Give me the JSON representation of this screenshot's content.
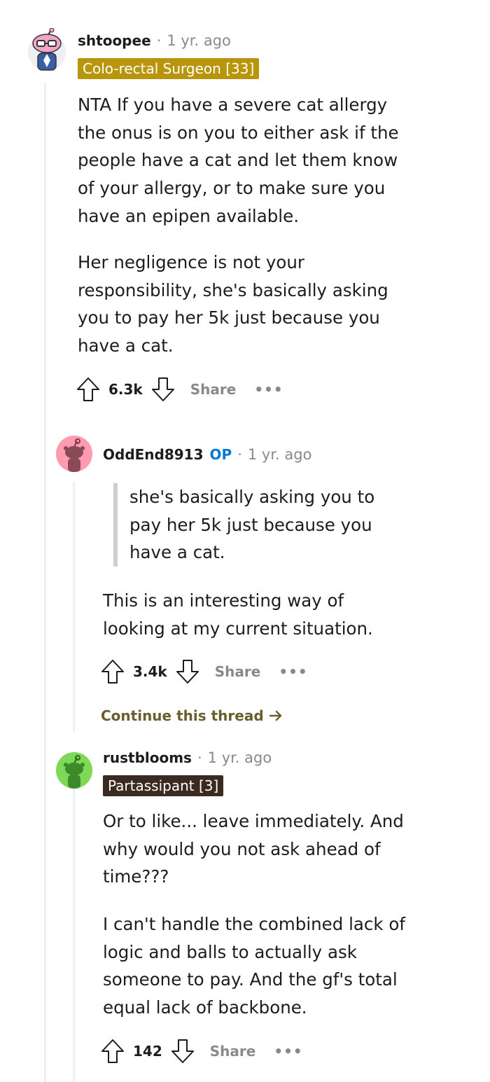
{
  "comments": [
    {
      "username": "shtoopee",
      "time": "1 yr. ago",
      "flair": "Colo-rectal Surgeon [33]",
      "flair_color": "#b8950b",
      "paragraphs": [
        "NTA If you have a severe cat allergy the onus is on you to either ask if the people have a cat and let them know of your allergy, or to make sure you have an epipen available.",
        "Her negligence is not your responsibility, she's basically asking you to pay her 5k just because you have a cat."
      ],
      "score": "6.3k",
      "share_label": "Share",
      "more_label": "•••",
      "avatar_icon": "snoo-avatar-pink-glasses"
    },
    {
      "username": "OddEnd8913",
      "op_badge": "OP",
      "time": "1 yr. ago",
      "quote": "she's basically asking you to pay her 5k just because you have a cat.",
      "paragraphs": [
        "This is an interesting way of looking at my current situation."
      ],
      "score": "3.4k",
      "share_label": "Share",
      "more_label": "•••",
      "continue_label": "Continue this thread",
      "avatar_icon": "snoo-avatar-default-pink"
    },
    {
      "username": "rustblooms",
      "time": "1 yr. ago",
      "flair": "Partassipant [3]",
      "flair_color": "#3b2a22",
      "paragraphs": [
        "Or to like... leave immediately. And why would you not ask ahead of time???",
        "I can't handle the combined lack of logic and balls to actually ask someone to pay. And the gf's total equal lack of backbone."
      ],
      "score": "142",
      "share_label": "Share",
      "more_label": "•••",
      "avatar_icon": "snoo-avatar-default-green"
    }
  ],
  "colors": {
    "accent_op": "#0079d3",
    "muted": "#878a8c",
    "thread_line": "#edeff1"
  }
}
